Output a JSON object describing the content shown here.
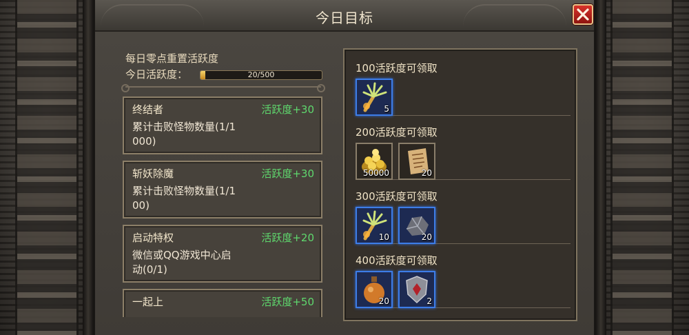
{
  "window": {
    "title": "今日目标"
  },
  "header": {
    "reset_note": "每日零点重置活跃度",
    "activity_label": "今日活跃度：",
    "activity_text": "20/500",
    "activity_fraction": 0.04
  },
  "tasks": [
    {
      "name": "终结者",
      "points": "活跃度+30",
      "desc_line1": "累计击败怪物数量(1/1",
      "desc_line2": "000)"
    },
    {
      "name": "斩妖除魔",
      "points": "活跃度+30",
      "desc_line1": "累计击败怪物数量(1/1",
      "desc_line2": "00)"
    },
    {
      "name": "启动特权",
      "points": "活跃度+20",
      "desc_line1": "微信或QQ游戏中心启",
      "desc_line2": "动(0/1)"
    },
    {
      "name": "一起上",
      "points": "活跃度+50",
      "desc_line1": "",
      "desc_line2": ""
    }
  ],
  "reward_tiers": [
    {
      "label": "100活跃度可领取",
      "items": [
        {
          "icon": "herb-bundle-icon",
          "count": "5",
          "quality": "blue"
        }
      ]
    },
    {
      "label": "200活跃度可领取",
      "items": [
        {
          "icon": "gold-coins-icon",
          "count": "50000",
          "quality": "plain"
        },
        {
          "icon": "scroll-icon",
          "count": "20",
          "quality": "plain"
        }
      ]
    },
    {
      "label": "300活跃度可领取",
      "items": [
        {
          "icon": "herb-bundle-icon",
          "count": "10",
          "quality": "blue"
        },
        {
          "icon": "ore-icon",
          "count": "20",
          "quality": "blue"
        }
      ]
    },
    {
      "label": "400活跃度可领取",
      "items": [
        {
          "icon": "potion-icon",
          "count": "20",
          "quality": "blue"
        },
        {
          "icon": "shield-icon",
          "count": "2",
          "quality": "blue"
        }
      ]
    }
  ],
  "colors": {
    "points_green": "#5fd96e",
    "blue_quality": "#3d7de8",
    "close_red": "#d8332a"
  }
}
